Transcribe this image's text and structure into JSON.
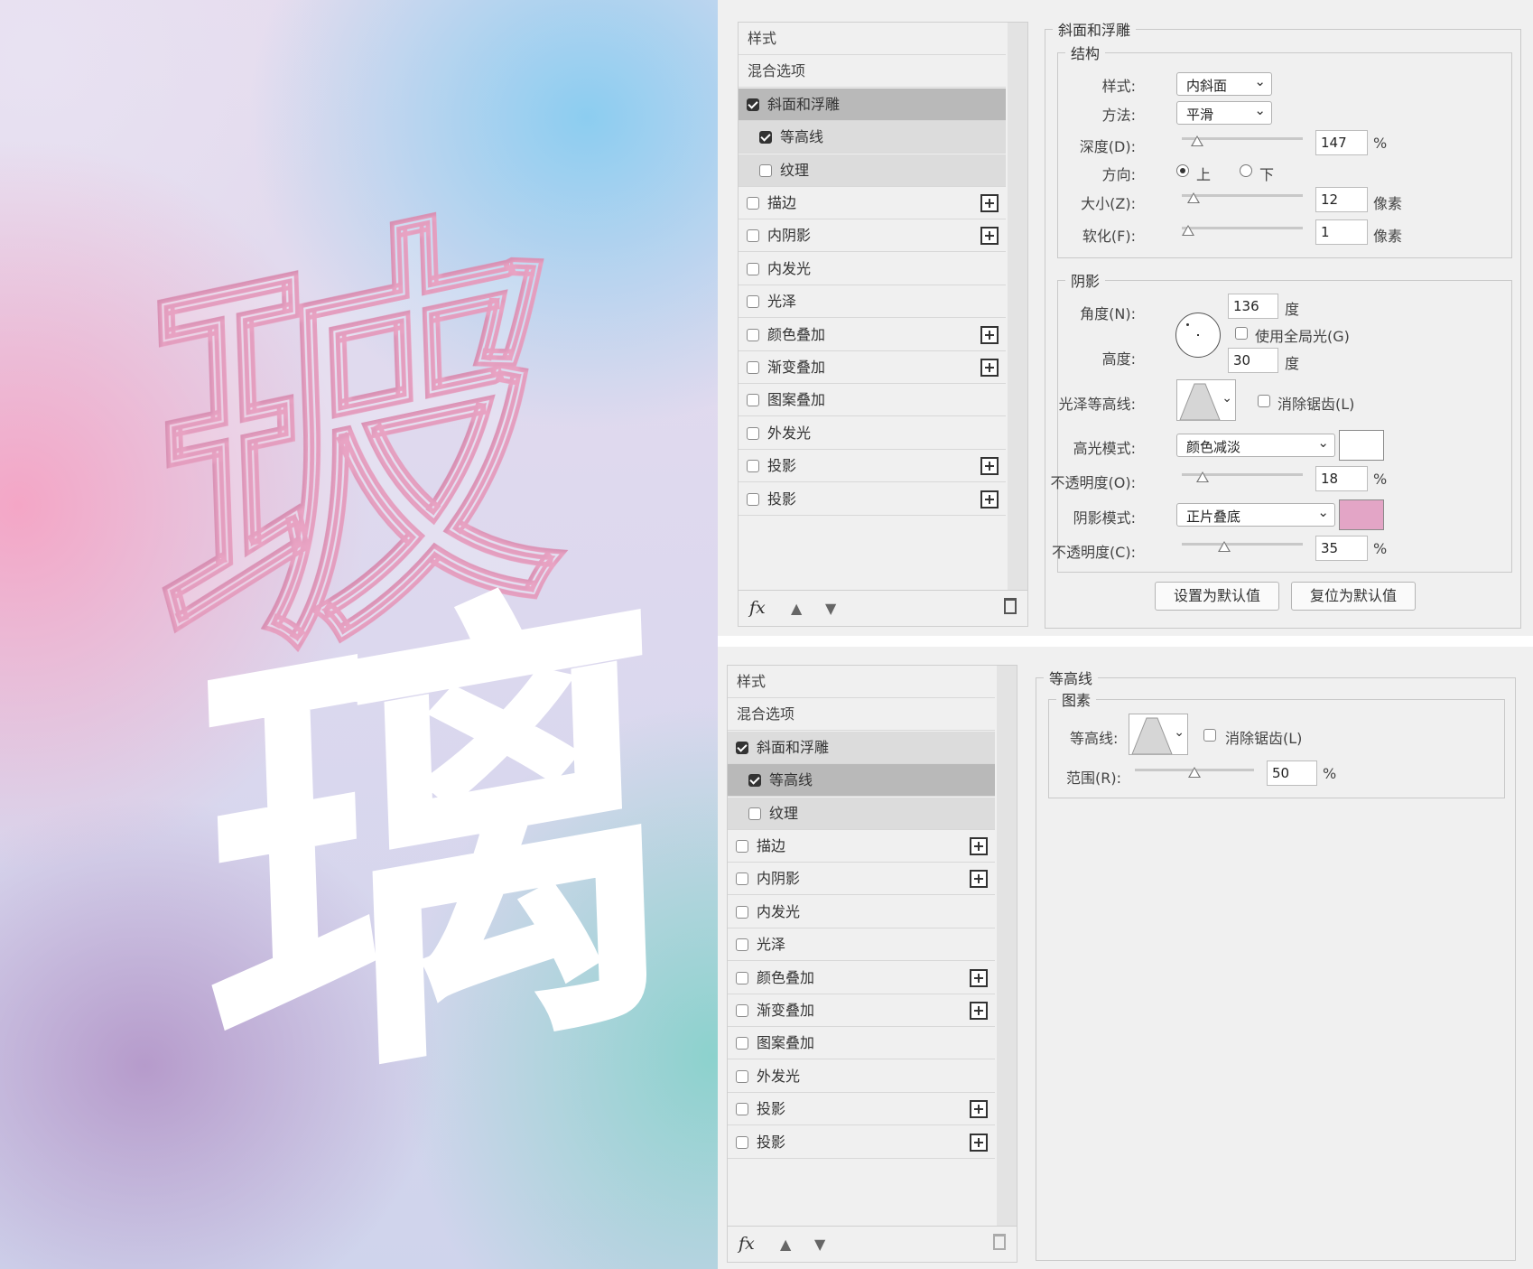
{
  "artwork": {
    "char_top": "玻",
    "char_bottom": "璃"
  },
  "styles_list_labels": {
    "header": "样式",
    "blend": "混合选项"
  },
  "panel_top": {
    "items": [
      {
        "label": "斜面和浮雕",
        "checked": true,
        "state": "active",
        "indent": false,
        "plus": false
      },
      {
        "label": "等高线",
        "checked": true,
        "state": "grp",
        "indent": true,
        "plus": false
      },
      {
        "label": "纹理",
        "checked": false,
        "state": "grp",
        "indent": true,
        "plus": false
      },
      {
        "label": "描边",
        "checked": false,
        "state": "",
        "indent": false,
        "plus": true
      },
      {
        "label": "内阴影",
        "checked": false,
        "state": "",
        "indent": false,
        "plus": true
      },
      {
        "label": "内发光",
        "checked": false,
        "state": "",
        "indent": false,
        "plus": false
      },
      {
        "label": "光泽",
        "checked": false,
        "state": "",
        "indent": false,
        "plus": false
      },
      {
        "label": "颜色叠加",
        "checked": false,
        "state": "",
        "indent": false,
        "plus": true
      },
      {
        "label": "渐变叠加",
        "checked": false,
        "state": "",
        "indent": false,
        "plus": true
      },
      {
        "label": "图案叠加",
        "checked": false,
        "state": "",
        "indent": false,
        "plus": false
      },
      {
        "label": "外发光",
        "checked": false,
        "state": "",
        "indent": false,
        "plus": false
      },
      {
        "label": "投影",
        "checked": false,
        "state": "",
        "indent": false,
        "plus": true
      },
      {
        "label": "投影",
        "checked": false,
        "state": "",
        "indent": false,
        "plus": true
      }
    ]
  },
  "panel_bottom": {
    "items": [
      {
        "label": "斜面和浮雕",
        "checked": true,
        "state": "grp",
        "indent": false,
        "plus": false
      },
      {
        "label": "等高线",
        "checked": true,
        "state": "active",
        "indent": true,
        "plus": false
      },
      {
        "label": "纹理",
        "checked": false,
        "state": "grp",
        "indent": true,
        "plus": false
      },
      {
        "label": "描边",
        "checked": false,
        "state": "",
        "indent": false,
        "plus": true
      },
      {
        "label": "内阴影",
        "checked": false,
        "state": "",
        "indent": false,
        "plus": true
      },
      {
        "label": "内发光",
        "checked": false,
        "state": "",
        "indent": false,
        "plus": false
      },
      {
        "label": "光泽",
        "checked": false,
        "state": "",
        "indent": false,
        "plus": false
      },
      {
        "label": "颜色叠加",
        "checked": false,
        "state": "",
        "indent": false,
        "plus": true
      },
      {
        "label": "渐变叠加",
        "checked": false,
        "state": "",
        "indent": false,
        "plus": true
      },
      {
        "label": "图案叠加",
        "checked": false,
        "state": "",
        "indent": false,
        "plus": false
      },
      {
        "label": "外发光",
        "checked": false,
        "state": "",
        "indent": false,
        "plus": false
      },
      {
        "label": "投影",
        "checked": false,
        "state": "",
        "indent": false,
        "plus": true
      },
      {
        "label": "投影",
        "checked": false,
        "state": "",
        "indent": false,
        "plus": true
      }
    ]
  },
  "bevel": {
    "title": "斜面和浮雕",
    "structure": "结构",
    "style_label": "样式:",
    "style_value": "内斜面",
    "method_label": "方法:",
    "method_value": "平滑",
    "depth_label": "深度(D):",
    "depth_value": "147",
    "depth_unit": "%",
    "direction_label": "方向:",
    "dir_up": "上",
    "dir_down": "下",
    "size_label": "大小(Z):",
    "size_value": "12",
    "size_unit": "像素",
    "soften_label": "软化(F):",
    "soften_value": "1",
    "soften_unit": "像素",
    "shading": "阴影",
    "angle_label": "角度(N):",
    "angle_value": "136",
    "angle_unit": "度",
    "global_light": "使用全局光(G)",
    "altitude_label": "高度:",
    "altitude_value": "30",
    "altitude_unit": "度",
    "gloss_label": "光泽等高线:",
    "antialias": "消除锯齿(L)",
    "highlight_label": "高光模式:",
    "highlight_mode": "颜色减淡",
    "highlight_color": "#ffffff",
    "hl_opacity_label": "不透明度(O):",
    "hl_opacity": "18",
    "hl_opacity_unit": "%",
    "shadow_label": "阴影模式:",
    "shadow_mode": "正片叠底",
    "shadow_color": "#e3a5c6",
    "sh_opacity_label": "不透明度(C):",
    "sh_opacity": "35",
    "sh_opacity_unit": "%",
    "btn_default": "设置为默认值",
    "btn_reset": "复位为默认值"
  },
  "contour": {
    "title": "等高线",
    "elements": "图素",
    "contour_label": "等高线:",
    "antialias": "消除锯齿(L)",
    "range_label": "范围(R):",
    "range_value": "50",
    "range_unit": "%"
  },
  "icons": {
    "fx": "fx",
    "up": "▲",
    "down": "▼"
  }
}
